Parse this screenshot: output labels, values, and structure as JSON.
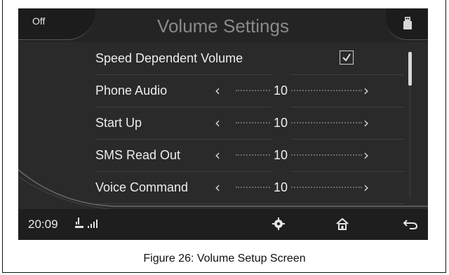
{
  "header": {
    "off_label": "Off",
    "title": "Volume Settings"
  },
  "settings": {
    "speed_dependent": {
      "label": "Speed Dependent Volume",
      "checked": true
    },
    "items": [
      {
        "label": "Phone Audio",
        "value": "10"
      },
      {
        "label": "Start Up",
        "value": "10"
      },
      {
        "label": "SMS Read Out",
        "value": "10"
      },
      {
        "label": "Voice Command",
        "value": "10"
      }
    ]
  },
  "bottom_bar": {
    "time": "20:09",
    "icons": [
      "usb-icon",
      "signal-icon",
      "settings-gear-icon",
      "home-icon",
      "back-icon"
    ]
  },
  "caption": "Figure 26: Volume Setup Screen"
}
